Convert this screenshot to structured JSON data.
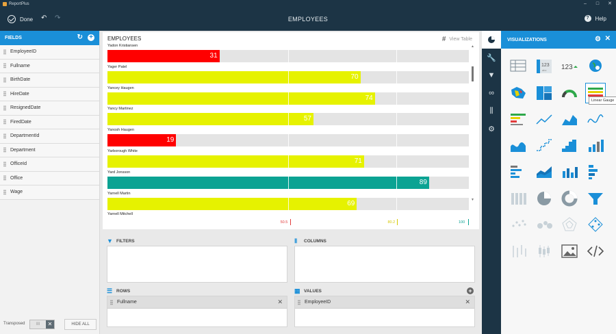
{
  "window": {
    "app_name": "ReportPlus",
    "minimize": "–",
    "maximize": "□",
    "close": "✕"
  },
  "toolbar": {
    "done_label": "Done",
    "title": "EMPLOYEES",
    "help_label": "Help"
  },
  "fields": {
    "header": "FIELDS",
    "items": [
      "EmployeeID",
      "Fullname",
      "BirthDate",
      "HireDate",
      "ResignedDate",
      "FiredDate",
      "DepartmentId",
      "Department",
      "OfficeId",
      "Office",
      "Wage"
    ],
    "transposed_label": "Transposed",
    "hide_all_label": "HIDE ALL"
  },
  "widget": {
    "title": "EMPLOYEES",
    "view_table_label": "View Table",
    "rows": [
      {
        "name": "Yadon Kristiansen",
        "value": 31,
        "color": "#ff0000"
      },
      {
        "name": "Yager Patel",
        "value": 70,
        "color": "#e6f200"
      },
      {
        "name": "Yancey Haugen",
        "value": 74,
        "color": "#e6f200"
      },
      {
        "name": "Yancy Martinez",
        "value": 57,
        "color": "#e6f200"
      },
      {
        "name": "Yanosh Haugen",
        "value": 19,
        "color": "#ff0000"
      },
      {
        "name": "Yarborough White",
        "value": 71,
        "color": "#e6f200"
      },
      {
        "name": "Yard Jonsson",
        "value": 89,
        "color": "#0ba393"
      },
      {
        "name": "Yarnell Martin",
        "value": 69,
        "color": "#e6f200"
      },
      {
        "name": "Yarnell Mitchell",
        "value": null,
        "color": "#e6f200"
      }
    ],
    "scale_labels": [
      {
        "text": "50.5",
        "color": "#e23b3b"
      },
      {
        "text": "80.2",
        "color": "#d6c800"
      },
      {
        "text": "100",
        "color": "#0ba393"
      }
    ],
    "scale_values": [
      50.5,
      80.2,
      100
    ]
  },
  "filters": {
    "label": "FILTERS"
  },
  "columns": {
    "label": "COLUMNS"
  },
  "rows_section": {
    "label": "ROWS",
    "items": [
      "Fullname"
    ]
  },
  "values_section": {
    "label": "VALUES",
    "items": [
      "EmployeeID"
    ]
  },
  "visualizations": {
    "header": "VISUALIZATIONS",
    "tooltip": "Linear Gauge",
    "icons": [
      "grid-icon",
      "text-123-icon",
      "kpi-123-icon",
      "map-marker-icon",
      "choropleth-map-icon",
      "treemap-icon",
      "circular-gauge-icon",
      "linear-gauge-icon",
      "bullet-graph-icon",
      "line-chart-icon",
      "area-chart-icon",
      "spline-chart-icon",
      "spline-area-icon",
      "step-line-icon",
      "step-area-icon",
      "column-chart-icon",
      "bar-chart-icon",
      "stacked-area-icon",
      "stacked-column-icon",
      "stacked-bar-icon",
      "stacked-100-column-icon",
      "pie-chart-icon",
      "doughnut-chart-icon",
      "funnel-chart-icon",
      "scatter-chart-icon",
      "bubble-chart-icon",
      "radar-chart-icon",
      "polar-chart-icon",
      "ohlc-chart-icon",
      "candlestick-chart-icon",
      "image-icon",
      "code-icon"
    ],
    "accent": "#1a8fd8"
  }
}
